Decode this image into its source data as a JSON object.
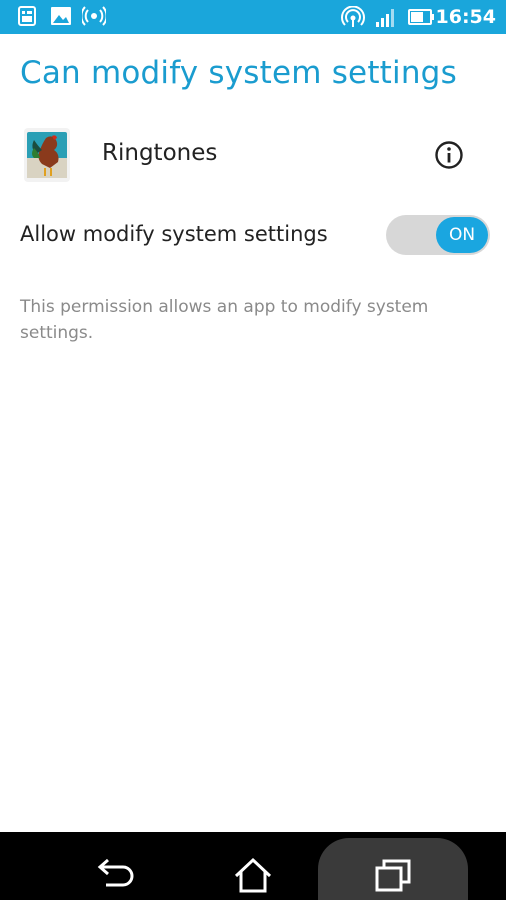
{
  "status_bar": {
    "time": "16:54",
    "icons_left": [
      "sim-card-icon",
      "image-icon",
      "broadcast-icon"
    ],
    "icons_right": [
      "hotspot-icon",
      "signal-icon",
      "battery-icon"
    ],
    "background": "#1aa6db"
  },
  "header": {
    "title": "Can modify system settings"
  },
  "app": {
    "name": "Ringtones",
    "icon": "rooster-app-icon"
  },
  "permission": {
    "label": "Allow modify system settings",
    "toggle_label": "ON",
    "enabled": true
  },
  "description": "This permission allows an app to modify system settings.",
  "nav_bar": {
    "buttons": [
      "back-icon",
      "home-icon",
      "recents-icon"
    ]
  },
  "colors": {
    "accent": "#1aa6db",
    "title": "#1a9ccf",
    "toggle_on": "#1aa6e0"
  }
}
